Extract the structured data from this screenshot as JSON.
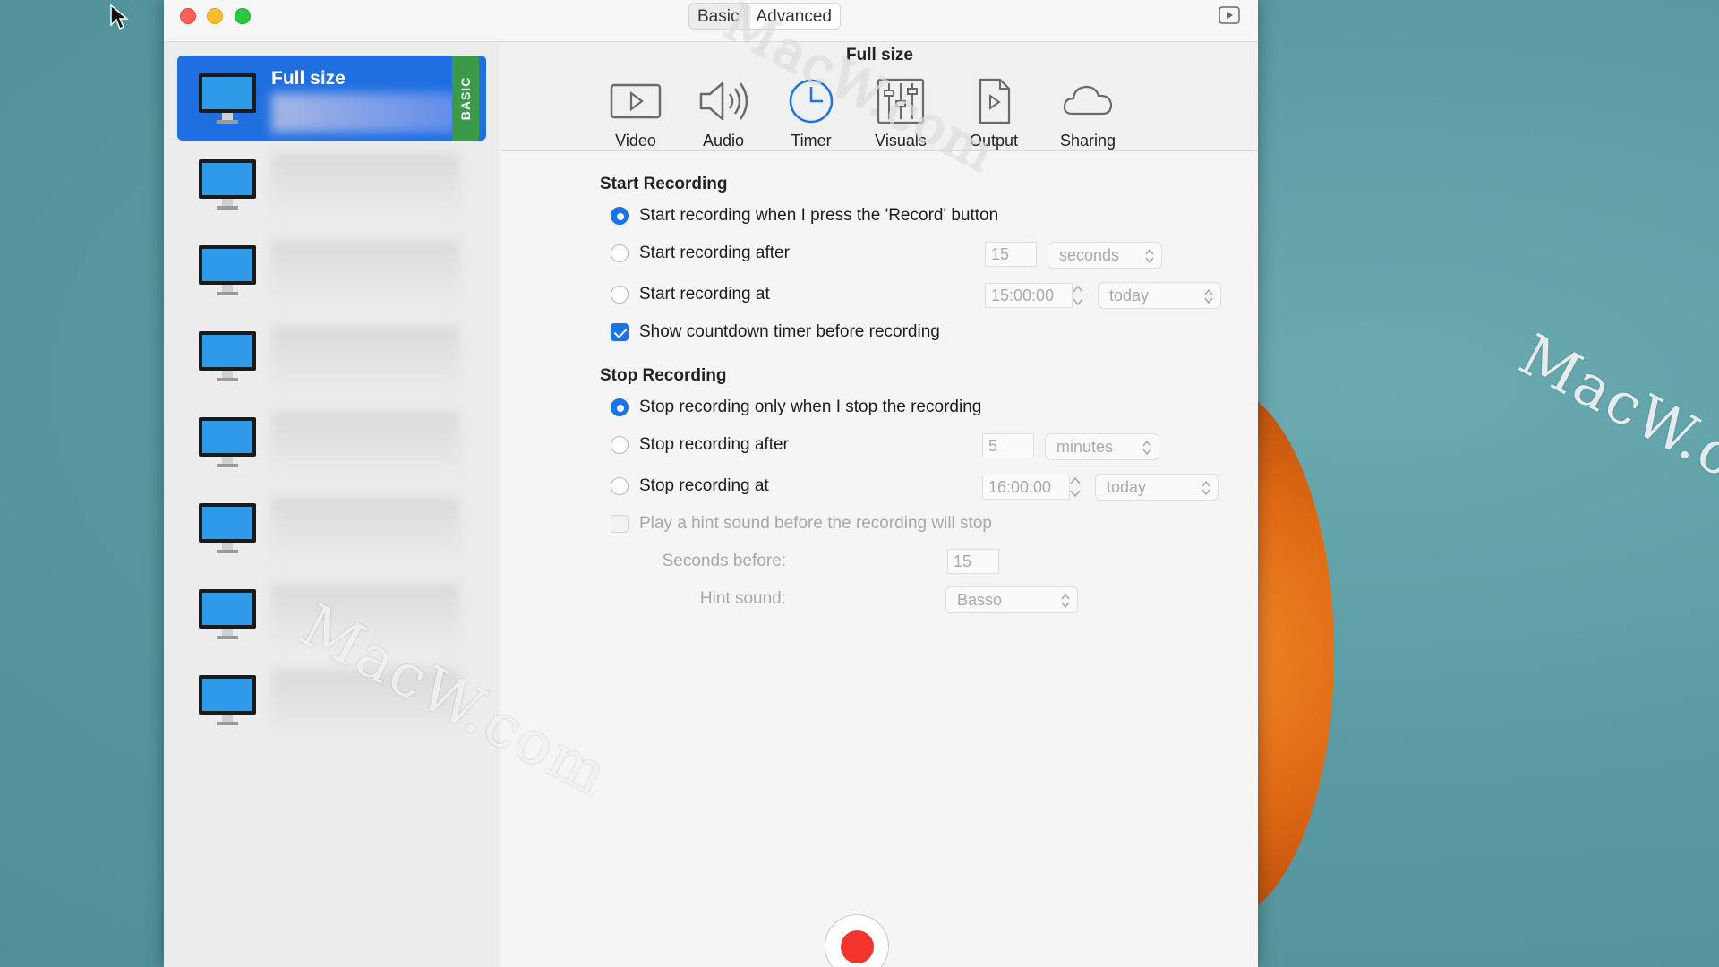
{
  "window": {
    "segments": {
      "basic": "Basic",
      "advanced": "Advanced"
    },
    "title": "Full size"
  },
  "sidebar": {
    "selected_preset": {
      "title": "Full size",
      "badge": "BASIC"
    },
    "preset_count": 8
  },
  "toolbar": {
    "items": [
      {
        "label": "Video",
        "icon": "video-icon"
      },
      {
        "label": "Audio",
        "icon": "speaker-icon"
      },
      {
        "label": "Timer",
        "icon": "clock-icon"
      },
      {
        "label": "Visuals",
        "icon": "sliders-icon"
      },
      {
        "label": "Output",
        "icon": "document-icon"
      },
      {
        "label": "Sharing",
        "icon": "cloud-icon"
      }
    ],
    "active": "Timer"
  },
  "start": {
    "heading": "Start Recording",
    "option_press": "Start recording when I press the 'Record' button",
    "option_after": "Start recording after",
    "after_value": "15",
    "after_unit": "seconds",
    "option_at": "Start recording at",
    "at_time": "15:00:00",
    "at_day": "today",
    "countdown": "Show countdown timer before recording"
  },
  "stop": {
    "heading": "Stop Recording",
    "option_manual": "Stop recording only when I stop the recording",
    "option_after": "Stop recording after",
    "after_value": "5",
    "after_unit": "minutes",
    "option_at": "Stop recording at",
    "at_time": "16:00:00",
    "at_day": "today",
    "hint_sound_check": "Play a hint sound before the recording will stop",
    "seconds_before_label": "Seconds before:",
    "seconds_before_value": "15",
    "hint_sound_label": "Hint sound:",
    "hint_sound_value": "Basso"
  },
  "watermark": "MacW.com",
  "colors": {
    "accent": "#1a73e8",
    "selected_preset": "#1f6fe0",
    "record": "#f2352a",
    "badge": "#3a9a4a"
  }
}
